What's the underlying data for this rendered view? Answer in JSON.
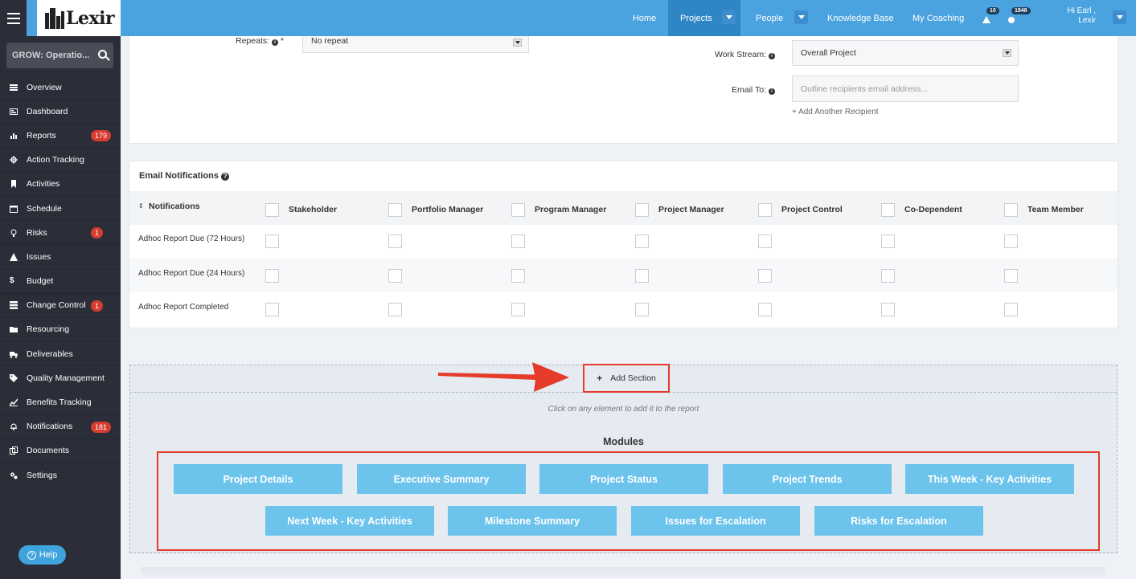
{
  "topbar": {
    "logo_text": "Lexir",
    "nav": [
      {
        "label": "Home"
      },
      {
        "label": "Projects"
      },
      {
        "label": "People"
      },
      {
        "label": "Knowledge Base"
      },
      {
        "label": "My Coaching"
      }
    ],
    "alerts_count": "10",
    "messages_count": "1848",
    "greeting": "Hi Earl ,",
    "user_name": "Lexir"
  },
  "sidebar": {
    "search_text": "GROW: Operatio...",
    "items": [
      {
        "label": "Overview",
        "icon": "list-icon"
      },
      {
        "label": "Dashboard",
        "icon": "dashboard-icon"
      },
      {
        "label": "Reports",
        "icon": "bar-chart-icon",
        "count": "179"
      },
      {
        "label": "Action Tracking",
        "icon": "crosshair-icon"
      },
      {
        "label": "Activities",
        "icon": "bookmark-icon"
      },
      {
        "label": "Schedule",
        "icon": "calendar-icon"
      },
      {
        "label": "Risks",
        "icon": "lightbulb-icon",
        "count": "1"
      },
      {
        "label": "Issues",
        "icon": "warning-icon"
      },
      {
        "label": "Budget",
        "icon": "dollar-icon"
      },
      {
        "label": "Change Control",
        "icon": "server-icon",
        "count": "1"
      },
      {
        "label": "Resourcing",
        "icon": "folder-icon"
      },
      {
        "label": "Deliverables",
        "icon": "truck-icon"
      },
      {
        "label": "Quality Management",
        "icon": "tag-icon"
      },
      {
        "label": "Benefits Tracking",
        "icon": "line-chart-icon"
      },
      {
        "label": "Notifications",
        "icon": "bell-icon",
        "count": "181"
      },
      {
        "label": "Documents",
        "icon": "documents-icon"
      },
      {
        "label": "Settings",
        "icon": "cogs-icon"
      }
    ],
    "help_label": "Help"
  },
  "form": {
    "repeats_label": "Repeats:",
    "repeats_required": "*",
    "repeats_value": "No repeat",
    "workstream_label": "Work Stream:",
    "workstream_value": "Overall Project",
    "email_to_label": "Email To:",
    "email_to_placeholder": "Outline recipients email address...",
    "add_recipient": "+ Add Another Recipient"
  },
  "email_notifications": {
    "title": "Email Notifications",
    "first_column": "Notifications",
    "columns": [
      "Stakeholder",
      "Portfolio Manager",
      "Program Manager",
      "Project Manager",
      "Project Control",
      "Co-Dependent",
      "Team Member"
    ],
    "rows": [
      "Adhoc Report Due (72 Hours)",
      "Adhoc Report Due (24 Hours)",
      "Adhoc Report Completed"
    ]
  },
  "builder": {
    "add_section_label": "Add Section",
    "hint": "Click on any element to add it to the report",
    "modules_title": "Modules",
    "modules": [
      "Project Details",
      "Executive Summary",
      "Project Status",
      "Project Trends",
      "This Week - Key Activities",
      "Next Week - Key Activities",
      "Milestone Summary",
      "Issues for Escalation",
      "Risks for Escalation"
    ]
  },
  "colors": {
    "topbar": "#4aa3df",
    "sidebar": "#2b2e38",
    "badge": "#d63c2f",
    "module_button": "#6cc3ec",
    "annotation_red": "#e43b2a"
  }
}
